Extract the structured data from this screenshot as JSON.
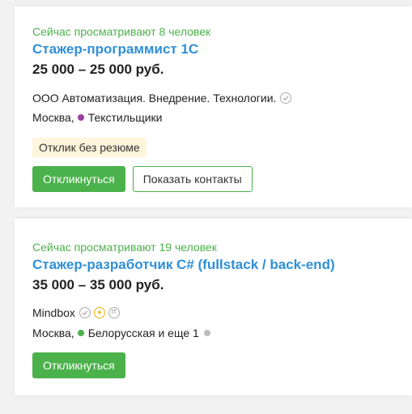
{
  "vacancies": [
    {
      "viewers": "Сейчас просматривают 8 человек",
      "title": "Стажер-программист 1С",
      "salary": "25 000 – 25 000 руб.",
      "company": "ООО Автоматизация. Внедрение. Технологии.",
      "city": "Москва,",
      "metro": "Текстильщики",
      "metro_color": "#9b3fa0",
      "tag": "Отклик без резюме",
      "respond_label": "Откликнуться",
      "contacts_label": "Показать контакты"
    },
    {
      "viewers": "Сейчас просматривают 19 человек",
      "title": "Стажер-разработчик C# (fullstack / back-end)",
      "salary": "35 000 – 35 000 руб.",
      "company": "Mindbox",
      "badge_it": "IT",
      "city": "Москва,",
      "metro": "Белорусская и еще 1",
      "metro_color": "#4bb24b",
      "respond_label": "Откликнуться"
    }
  ],
  "colors": {
    "accent_green": "#4bb24b",
    "title_blue": "#2f8fd8",
    "tag_bg": "#fff5dc"
  }
}
